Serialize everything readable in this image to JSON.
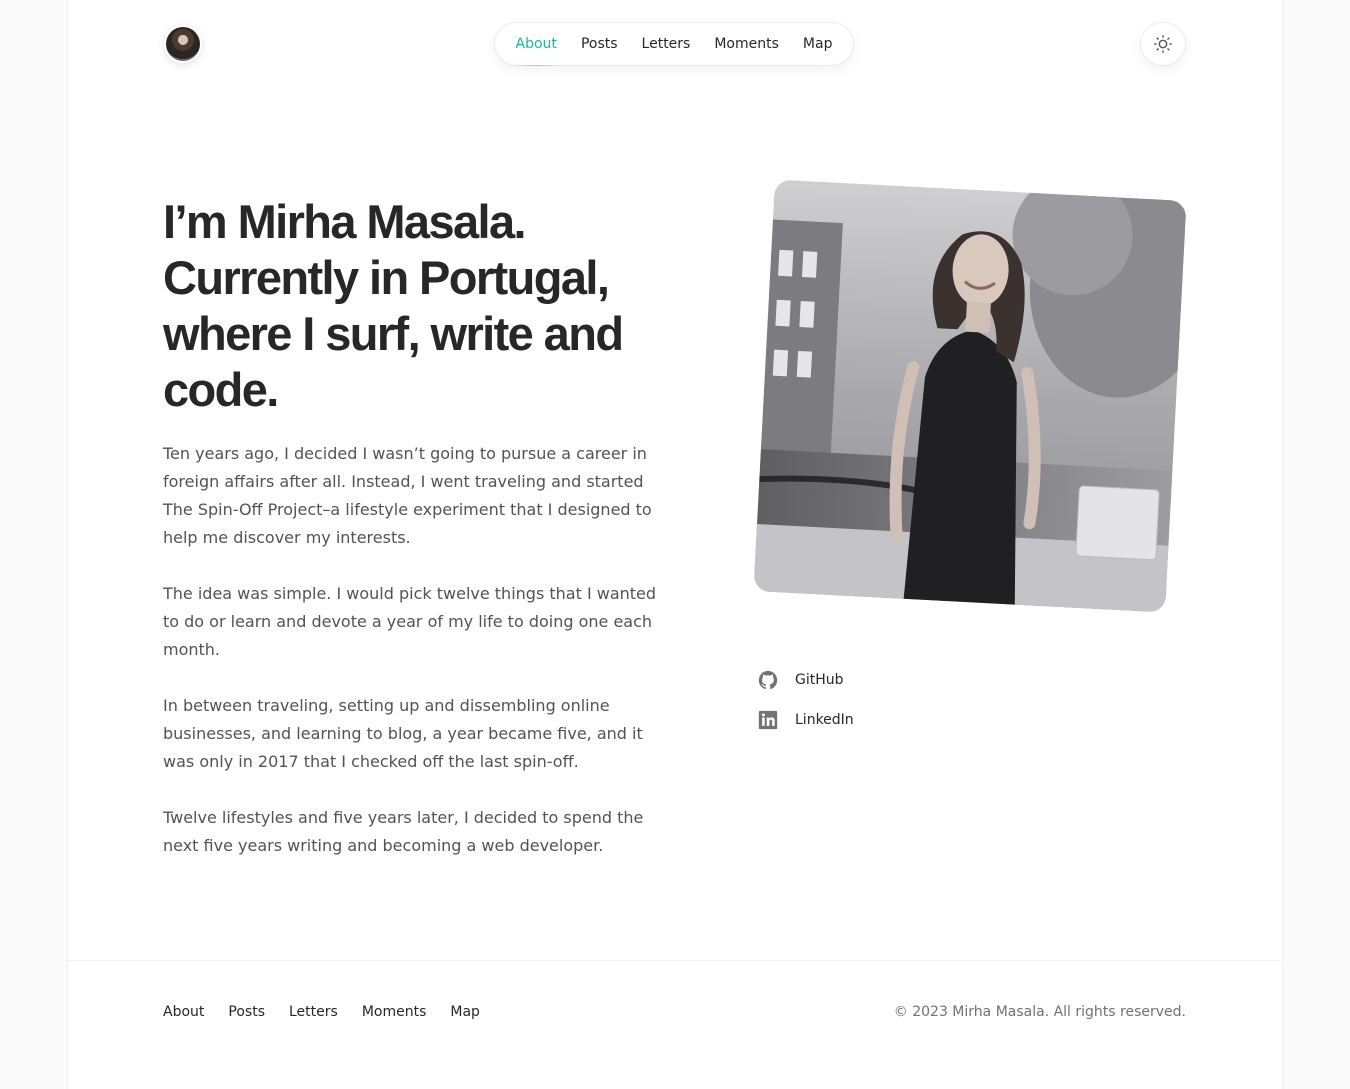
{
  "header": {
    "nav": [
      {
        "label": "About",
        "active": true
      },
      {
        "label": "Posts",
        "active": false
      },
      {
        "label": "Letters",
        "active": false
      },
      {
        "label": "Moments",
        "active": false
      },
      {
        "label": "Map",
        "active": false
      }
    ],
    "avatar_icon": "avatar",
    "theme_toggle_icon": "sun-icon"
  },
  "hero": {
    "headline": "I’m Mirha Masala. Currently in Portugal, where I surf, write and code.",
    "paragraphs": [
      "Ten years ago, I decided I wasn’t going to pursue a career in foreign affairs after all. Instead, I went traveling and started The Spin-Off Project–a lifestyle experiment that I designed to help me discover my interests.",
      "The idea was simple. I would pick twelve things that I wanted to do or learn and devote a year of my life to doing one each month.",
      "In between traveling, setting up and dissembling online businesses, and learning to blog, a year became five, and it was only in 2017 that I checked off the last spin-off.",
      "Twelve lifestyles and five years later, I decided to spend the next five years writing and becoming a web developer."
    ]
  },
  "social": [
    {
      "label": "GitHub",
      "icon": "github-icon"
    },
    {
      "label": "LinkedIn",
      "icon": "linkedin-icon"
    }
  ],
  "footer": {
    "nav": [
      "About",
      "Posts",
      "Letters",
      "Moments",
      "Map"
    ],
    "copyright": "© 2023 Mirha Masala. All rights reserved."
  },
  "colors": {
    "accent": "#14b8a6",
    "text": "#27272a",
    "muted": "#52525b"
  }
}
